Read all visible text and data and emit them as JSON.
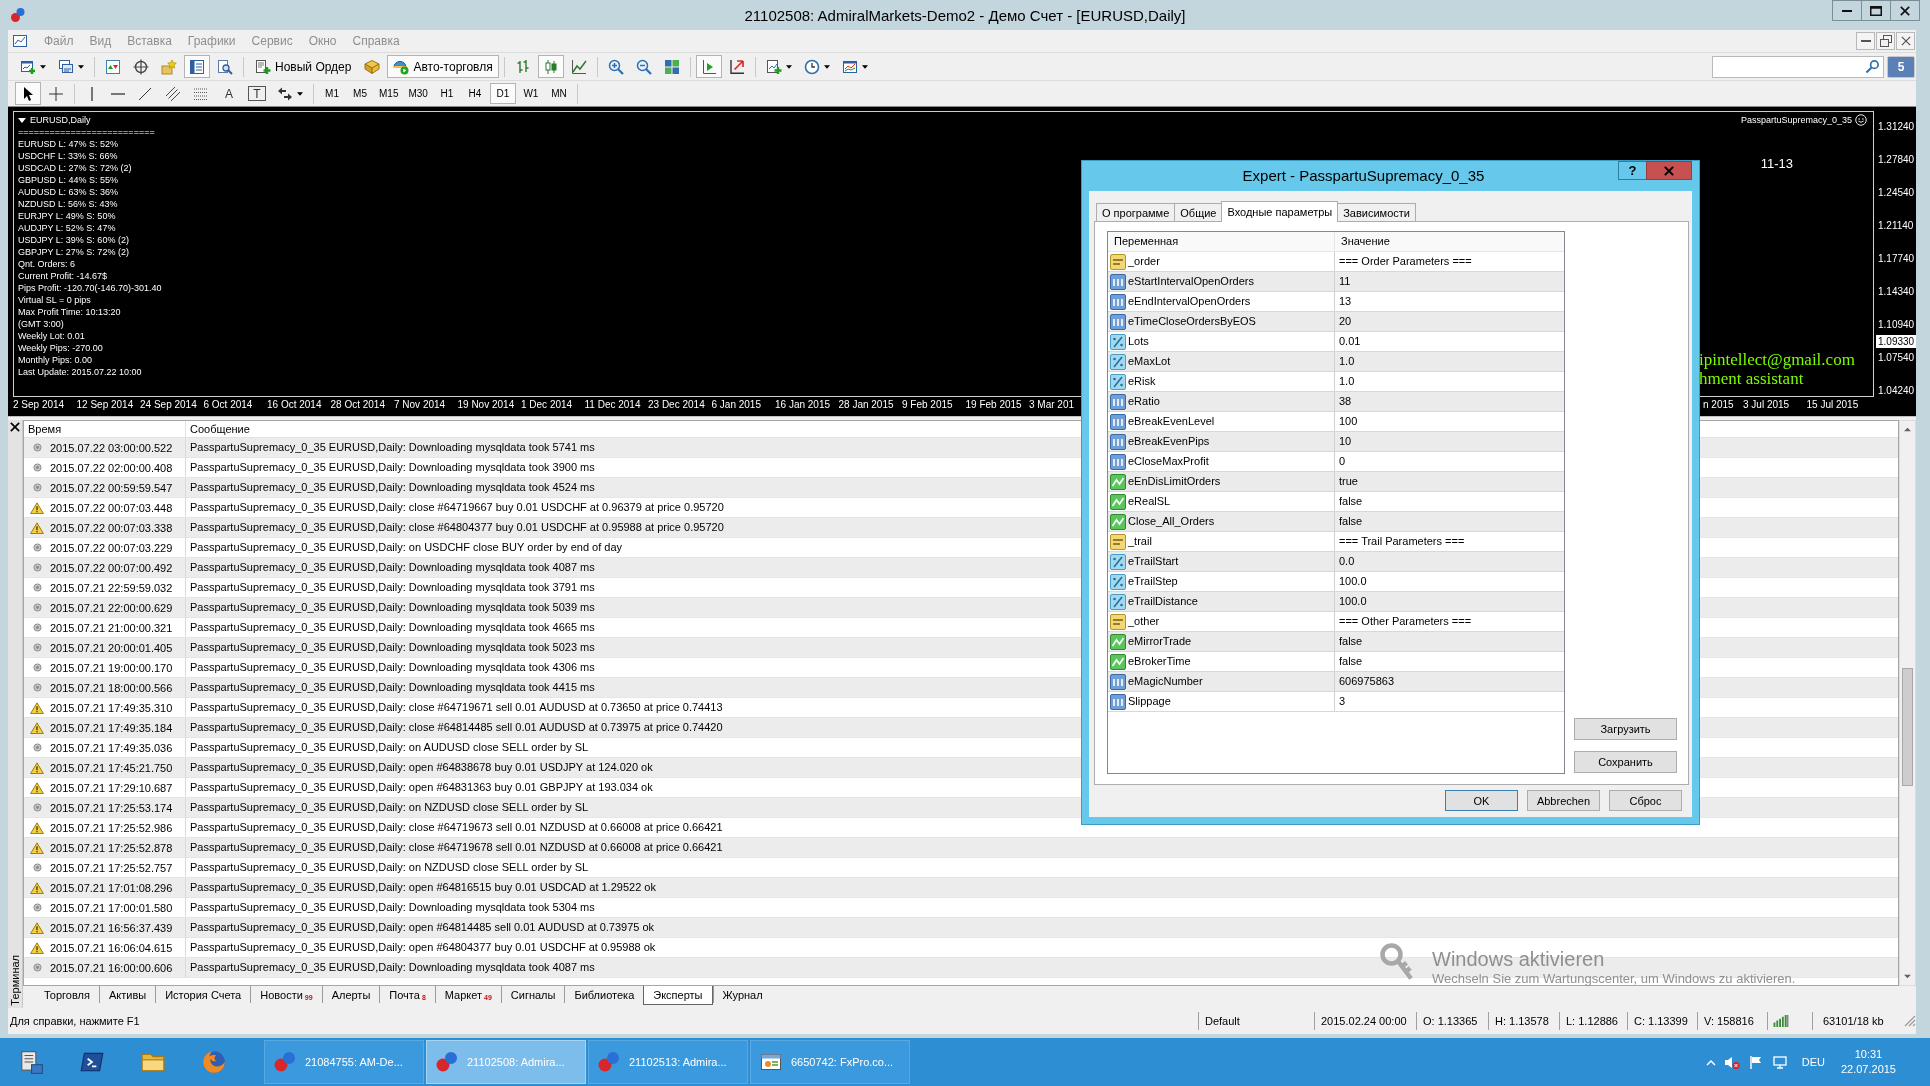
{
  "window": {
    "title": "21102508: AdmiralMarkets-Demo2 - Демо Счет - [EURUSD,Daily]"
  },
  "menu": [
    {
      "label": "Файл",
      "disabled": true
    },
    {
      "label": "Вид",
      "disabled": true
    },
    {
      "label": "Вставка",
      "disabled": true
    },
    {
      "label": "Графики",
      "disabled": true
    },
    {
      "label": "Сервис",
      "disabled": true
    },
    {
      "label": "Окно",
      "disabled": true
    },
    {
      "label": "Справка",
      "disabled": true
    }
  ],
  "toolbar": {
    "groups": [
      [
        {
          "kind": "dropdown",
          "on": false
        },
        {
          "kind": "dropdown",
          "on": false
        }
      ],
      [
        {
          "kind": "icon",
          "on": false
        },
        {
          "kind": "icon",
          "on": false
        },
        {
          "kind": "icon",
          "on": false
        },
        {
          "kind": "icon",
          "on": true
        },
        {
          "kind": "icon",
          "on": false
        }
      ],
      [
        {
          "kind": "button",
          "label": "Новый Ордер",
          "on": false
        },
        {
          "kind": "icon",
          "on": false
        },
        {
          "kind": "button",
          "label": "Авто-торговля",
          "on": true
        }
      ],
      [
        {
          "kind": "icon",
          "on": false
        },
        {
          "kind": "icon",
          "on": true
        },
        {
          "kind": "icon",
          "on": false
        }
      ],
      [
        {
          "kind": "icon",
          "on": false
        },
        {
          "kind": "icon",
          "on": false
        },
        {
          "kind": "icon",
          "on": false
        }
      ],
      [
        {
          "kind": "icon",
          "on": true
        },
        {
          "kind": "icon",
          "on": false
        }
      ],
      [
        {
          "kind": "dropdown",
          "on": false
        },
        {
          "kind": "dropdown",
          "on": false
        },
        {
          "kind": "dropdown",
          "on": false
        }
      ]
    ]
  },
  "community": {
    "count": "5"
  },
  "drawing_tools": {
    "groups": [
      [
        {
          "kind": "icon",
          "on": true
        },
        {
          "kind": "icon",
          "on": false
        }
      ],
      [
        {
          "kind": "icon",
          "on": false
        },
        {
          "kind": "icon",
          "on": false
        },
        {
          "kind": "icon",
          "on": false
        },
        {
          "kind": "icon",
          "on": false
        },
        {
          "kind": "icon",
          "on": false
        },
        {
          "kind": "text",
          "label": "A",
          "on": false
        },
        {
          "kind": "framed_text",
          "label": "T",
          "on": false
        },
        {
          "kind": "dropdown",
          "on": false
        }
      ]
    ]
  },
  "periods": [
    {
      "label": "M1",
      "selected": false
    },
    {
      "label": "M5",
      "selected": false
    },
    {
      "label": "M15",
      "selected": false
    },
    {
      "label": "M30",
      "selected": false
    },
    {
      "label": "H1",
      "selected": false
    },
    {
      "label": "H4",
      "selected": false
    },
    {
      "label": "D1",
      "selected": true
    },
    {
      "label": "W1",
      "selected": false
    },
    {
      "label": "MN",
      "selected": false
    }
  ],
  "chart": {
    "symbol": "EURUSD,Daily",
    "info_lines": [
      "==========================",
      "EURUSD L: 47% S: 52%",
      "USDCHF L: 33% S: 66%",
      "USDCAD L: 27% S: 72% (2)",
      "GBPUSD L: 44% S: 55%",
      "AUDUSD L: 63% S: 36%",
      "NZDUSD L: 56% S: 43%",
      "EURJPY L: 49% S: 50%",
      "AUDJPY L: 52% S: 47%",
      "USDJPY L: 39% S: 60% (2)",
      "GBPJPY L: 27% S: 72% (2)",
      "Qnt. Orders: 6",
      "Current Profit: -14.67$",
      "Pips Profit: -120.70(-146.70)-301.40",
      "Virtual SL = 0 pips",
      "Max Profit Time: 10:13:20",
      "(GMT 3:00)",
      "Weekly Lot: 0.01",
      "Weekly Pips: -270.00",
      "Monthly Pips: 0.00",
      "Last Update: 2015.07.22 10:00"
    ],
    "expert": "PasspartuSupremacy_0_35",
    "interval_label": "11-13",
    "contact_lines": [
      "ipintellect@gmail.com",
      "hment assistant"
    ],
    "prices": [
      "1.31240",
      "1.27840",
      "1.24540",
      "1.21140",
      "1.17740",
      "1.14340",
      "1.10940",
      "1.07540",
      "1.04240"
    ],
    "current_price": "1.09330",
    "dates": [
      "2 Sep 2014",
      "12 Sep 2014",
      "24 Sep 2014",
      "6 Oct 2014",
      "16 Oct 2014",
      "28 Oct 2014",
      "7 Nov 2014",
      "19 Nov 2014",
      "1 Dec 2014",
      "11 Dec 2014",
      "23 Dec 2014",
      "6 Jan 2015",
      "16 Jan 2015",
      "28 Jan 2015",
      "9 Feb 2015",
      "19 Feb 2015",
      "3 Mar 201"
    ],
    "dates_right": [
      "n 2015",
      "3 Jul 2015",
      "15 Jul 2015"
    ]
  },
  "terminal": {
    "title": "Терминал",
    "columns": [
      "Время",
      "Сообщение"
    ],
    "rows": [
      {
        "kind": "info",
        "time": "2015.07.22 03:00:00.522",
        "message": "PasspartuSupremacy_0_35 EURUSD,Daily: Downloading mysqldata took 5741 ms"
      },
      {
        "kind": "info",
        "time": "2015.07.22 02:00:00.408",
        "message": "PasspartuSupremacy_0_35 EURUSD,Daily: Downloading mysqldata took 3900 ms"
      },
      {
        "kind": "info",
        "time": "2015.07.22 00:59:59.547",
        "message": "PasspartuSupremacy_0_35 EURUSD,Daily: Downloading mysqldata took 4524 ms"
      },
      {
        "kind": "warning",
        "time": "2015.07.22 00:07:03.448",
        "message": "PasspartuSupremacy_0_35 EURUSD,Daily: close #64719667 buy 0.01 USDCHF at 0.96379 at price 0.95720"
      },
      {
        "kind": "warning",
        "time": "2015.07.22 00:07:03.338",
        "message": "PasspartuSupremacy_0_35 EURUSD,Daily: close #64804377 buy 0.01 USDCHF at 0.95988 at price 0.95720"
      },
      {
        "kind": "info",
        "time": "2015.07.22 00:07:03.229",
        "message": "PasspartuSupremacy_0_35 EURUSD,Daily: on USDCHF close BUY order by end of day"
      },
      {
        "kind": "info",
        "time": "2015.07.22 00:07:00.492",
        "message": "PasspartuSupremacy_0_35 EURUSD,Daily: Downloading mysqldata took 4087 ms"
      },
      {
        "kind": "info",
        "time": "2015.07.21 22:59:59.032",
        "message": "PasspartuSupremacy_0_35 EURUSD,Daily: Downloading mysqldata took 3791 ms"
      },
      {
        "kind": "info",
        "time": "2015.07.21 22:00:00.629",
        "message": "PasspartuSupremacy_0_35 EURUSD,Daily: Downloading mysqldata took 5039 ms"
      },
      {
        "kind": "info",
        "time": "2015.07.21 21:00:00.321",
        "message": "PasspartuSupremacy_0_35 EURUSD,Daily: Downloading mysqldata took 4665 ms"
      },
      {
        "kind": "info",
        "time": "2015.07.21 20:00:01.405",
        "message": "PasspartuSupremacy_0_35 EURUSD,Daily: Downloading mysqldata took 5023 ms"
      },
      {
        "kind": "info",
        "time": "2015.07.21 19:00:00.170",
        "message": "PasspartuSupremacy_0_35 EURUSD,Daily: Downloading mysqldata took 4306 ms"
      },
      {
        "kind": "info",
        "time": "2015.07.21 18:00:00.566",
        "message": "PasspartuSupremacy_0_35 EURUSD,Daily: Downloading mysqldata took 4415 ms"
      },
      {
        "kind": "warning",
        "time": "2015.07.21 17:49:35.310",
        "message": "PasspartuSupremacy_0_35 EURUSD,Daily: close #64719671 sell 0.01 AUDUSD at 0.73650 at price 0.74413"
      },
      {
        "kind": "warning",
        "time": "2015.07.21 17:49:35.184",
        "message": "PasspartuSupremacy_0_35 EURUSD,Daily: close #64814485 sell 0.01 AUDUSD at 0.73975 at price 0.74420"
      },
      {
        "kind": "info",
        "time": "2015.07.21 17:49:35.036",
        "message": "PasspartuSupremacy_0_35 EURUSD,Daily: on AUDUSD close SELL order by SL"
      },
      {
        "kind": "warning",
        "time": "2015.07.21 17:45:21.750",
        "message": "PasspartuSupremacy_0_35 EURUSD,Daily: open #64838678 buy 0.01 USDJPY at 124.020 ok"
      },
      {
        "kind": "warning",
        "time": "2015.07.21 17:29:10.687",
        "message": "PasspartuSupremacy_0_35 EURUSD,Daily: open #64831363 buy 0.01 GBPJPY at 193.034 ok"
      },
      {
        "kind": "info",
        "time": "2015.07.21 17:25:53.174",
        "message": "PasspartuSupremacy_0_35 EURUSD,Daily: on NZDUSD close SELL order by SL"
      },
      {
        "kind": "warning",
        "time": "2015.07.21 17:25:52.986",
        "message": "PasspartuSupremacy_0_35 EURUSD,Daily: close #64719673 sell 0.01 NZDUSD at 0.66008 at price 0.66421"
      },
      {
        "kind": "warning",
        "time": "2015.07.21 17:25:52.878",
        "message": "PasspartuSupremacy_0_35 EURUSD,Daily: close #64719678 sell 0.01 NZDUSD at 0.66008 at price 0.66421"
      },
      {
        "kind": "info",
        "time": "2015.07.21 17:25:52.757",
        "message": "PasspartuSupremacy_0_35 EURUSD,Daily: on NZDUSD close SELL order by SL"
      },
      {
        "kind": "warning",
        "time": "2015.07.21 17:01:08.296",
        "message": "PasspartuSupremacy_0_35 EURUSD,Daily: open #64816515 buy 0.01 USDCAD at 1.29522 ok"
      },
      {
        "kind": "info",
        "time": "2015.07.21 17:00:01.580",
        "message": "PasspartuSupremacy_0_35 EURUSD,Daily: Downloading mysqldata took 5304 ms"
      },
      {
        "kind": "warning",
        "time": "2015.07.21 16:56:37.439",
        "message": "PasspartuSupremacy_0_35 EURUSD,Daily: open #64814485 sell 0.01 AUDUSD at 0.73975 ok"
      },
      {
        "kind": "warning",
        "time": "2015.07.21 16:06:04.615",
        "message": "PasspartuSupremacy_0_35 EURUSD,Daily: open #64804377 buy 0.01 USDCHF at 0.95988 ok"
      },
      {
        "kind": "info",
        "time": "2015.07.21 16:00:00.606",
        "message": "PasspartuSupremacy_0_35 EURUSD,Daily: Downloading mysqldata took 4087 ms"
      }
    ],
    "tabs": [
      {
        "label": "Торговля",
        "selected": false
      },
      {
        "label": "Активы",
        "selected": false
      },
      {
        "label": "История Счета",
        "selected": false
      },
      {
        "label": "Новости",
        "badge": "99",
        "selected": false
      },
      {
        "label": "Алерты",
        "selected": false
      },
      {
        "label": "Почта",
        "badge": "8",
        "selected": false
      },
      {
        "label": "Маркет",
        "badge": "49",
        "selected": false
      },
      {
        "label": "Сигналы",
        "selected": false
      },
      {
        "label": "Библиотека",
        "selected": false
      },
      {
        "label": "Эксперты",
        "selected": true
      },
      {
        "label": "Журнал",
        "selected": false
      }
    ]
  },
  "os_notice": {
    "title": "Windows aktivieren",
    "message": "Wechseln Sie zum Wartungscenter, um Windows zu aktivieren."
  },
  "status_bar": {
    "help": "Для справки, нажмите F1",
    "profile": "Default",
    "bar_time": "2015.02.24 00:00",
    "open": "O: 1.13365",
    "high": "H: 1.13578",
    "low": "L: 1.12886",
    "close": "C: 1.13399",
    "volume": "V: 158816",
    "traffic": "63101/18 kb"
  },
  "taskbar": {
    "tasks": [
      {
        "label": "21084755: AM-De...",
        "kind": "circles",
        "selected": false
      },
      {
        "label": "21102508: Admira...",
        "kind": "circles",
        "selected": true
      },
      {
        "label": "21102513: Admira...",
        "kind": "circles",
        "selected": false
      },
      {
        "label": "6650742: FxPro.co...",
        "kind": "window",
        "selected": false
      }
    ],
    "language": "DEU",
    "time": "10:31",
    "date": "22.07.2015"
  },
  "dialog": {
    "title": "Expert - PasspartuSupremacy_0_35",
    "help": "?",
    "tabs": [
      {
        "label": "О программе",
        "selected": false
      },
      {
        "label": "Общие",
        "selected": false
      },
      {
        "label": "Входные параметры",
        "selected": true
      },
      {
        "label": "Зависимости",
        "selected": false
      }
    ],
    "columns": [
      "Переменная",
      "Значение"
    ],
    "params": [
      {
        "kind": "string",
        "name": "_order",
        "value": "=== Order Parameters ==="
      },
      {
        "kind": "int",
        "name": "eStartIntervalOpenOrders",
        "value": "11"
      },
      {
        "kind": "int",
        "name": "eEndIntervalOpenOrders",
        "value": "13"
      },
      {
        "kind": "int",
        "name": "eTimeCloseOrdersByEOS",
        "value": "20"
      },
      {
        "kind": "double",
        "name": "Lots",
        "value": "0.01"
      },
      {
        "kind": "double",
        "name": "eMaxLot",
        "value": "1.0"
      },
      {
        "kind": "double",
        "name": "eRisk",
        "value": "1.0"
      },
      {
        "kind": "int",
        "name": "eRatio",
        "value": "38"
      },
      {
        "kind": "int",
        "name": "eBreakEvenLevel",
        "value": "100"
      },
      {
        "kind": "int",
        "name": "eBreakEvenPips",
        "value": "10"
      },
      {
        "kind": "int",
        "name": "eCloseMaxProfit",
        "value": "0"
      },
      {
        "kind": "bool",
        "name": "eEnDisLimitOrders",
        "value": "true"
      },
      {
        "kind": "bool",
        "name": "eRealSL",
        "value": "false"
      },
      {
        "kind": "bool",
        "name": "Close_All_Orders",
        "value": "false"
      },
      {
        "kind": "string",
        "name": "_trail",
        "value": "=== Trail Parameters ==="
      },
      {
        "kind": "double",
        "name": "eTrailStart",
        "value": "0.0"
      },
      {
        "kind": "double",
        "name": "eTrailStep",
        "value": "100.0"
      },
      {
        "kind": "double",
        "name": "eTrailDistance",
        "value": "100.0"
      },
      {
        "kind": "string",
        "name": "_other",
        "value": "=== Other Parameters ==="
      },
      {
        "kind": "bool",
        "name": "eMirrorTrade",
        "value": "false"
      },
      {
        "kind": "bool",
        "name": "eBrokerTime",
        "value": "false"
      },
      {
        "kind": "int",
        "name": "eMagicNumber",
        "value": "606975863"
      },
      {
        "kind": "int",
        "name": "Slippage",
        "value": "3"
      }
    ],
    "side_buttons": [
      "Загрузить",
      "Сохранить"
    ],
    "buttons": [
      {
        "label": "OK",
        "default": true
      },
      {
        "label": "Abbrechen",
        "default": false
      },
      {
        "label": "Сброс",
        "default": false
      }
    ]
  }
}
